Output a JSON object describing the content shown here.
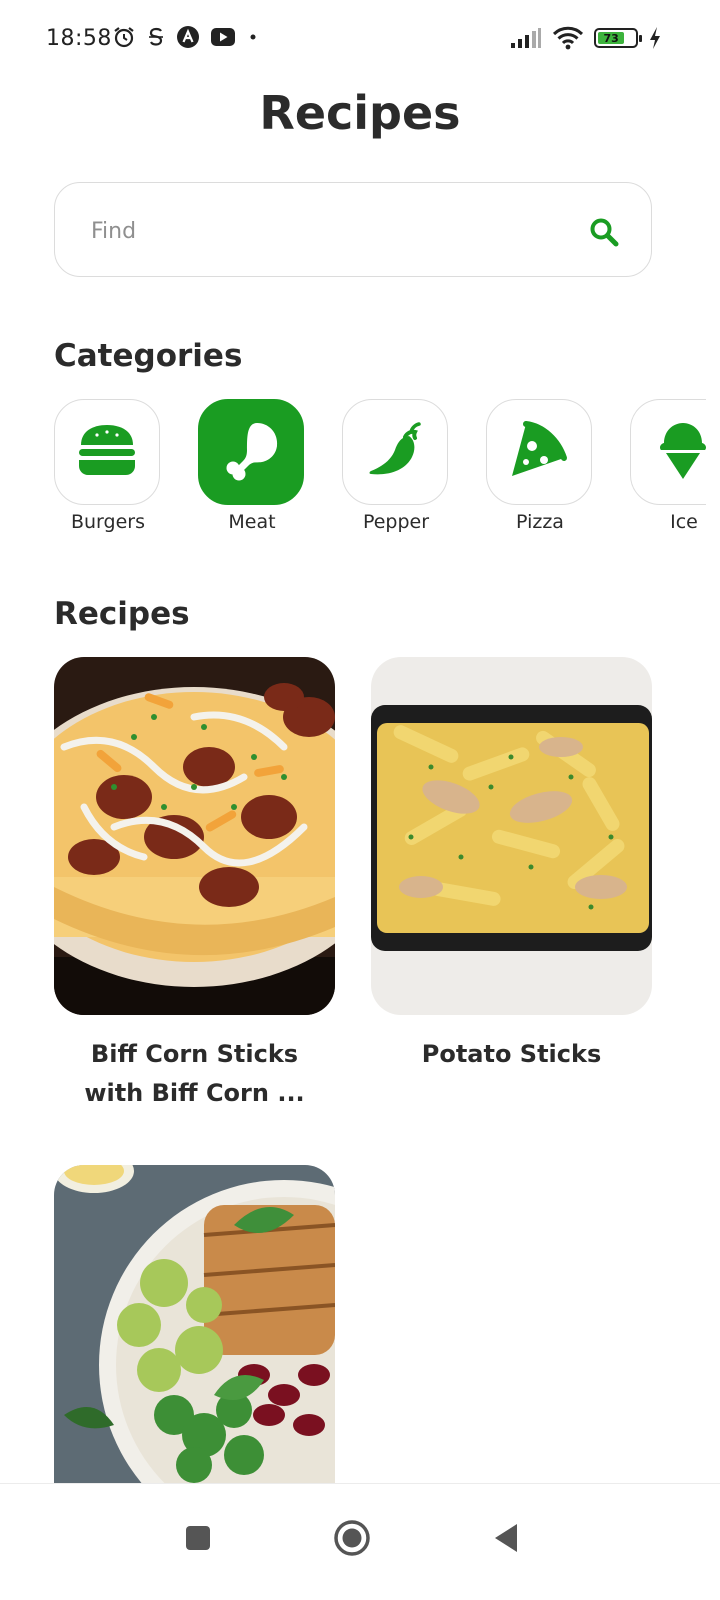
{
  "status_bar": {
    "time": "18:58",
    "battery_level": "73",
    "icons": [
      "alarm-icon",
      "s-badge-icon",
      "a-badge-icon",
      "youtube-icon",
      "dot-icon",
      "signal-icon",
      "wifi-icon",
      "battery-icon",
      "charging-icon"
    ]
  },
  "header": {
    "title": "Recipes"
  },
  "search": {
    "placeholder": "Find",
    "value": "",
    "icon": "search-icon"
  },
  "categories": {
    "title": "Categories",
    "items": [
      {
        "label": "Burgers",
        "icon": "burger-icon",
        "active": false
      },
      {
        "label": "Meat",
        "icon": "drumstick-icon",
        "active": true
      },
      {
        "label": "Pepper",
        "icon": "chili-pepper-icon",
        "active": false
      },
      {
        "label": "Pizza",
        "icon": "pizza-slice-icon",
        "active": false
      },
      {
        "label": "Ice",
        "icon": "ice-cream-icon",
        "active": false
      }
    ]
  },
  "recipes": {
    "title": "Recipes",
    "items": [
      {
        "title": "Biff Corn Sticks with Biff Corn ..."
      },
      {
        "title": "Potato Sticks"
      },
      {
        "title": ""
      }
    ]
  },
  "colors": {
    "accent": "#1a9c22",
    "text": "#2b2b2b",
    "border": "#dcdcdc"
  },
  "nav": {
    "icons": [
      "recents-square-icon",
      "home-circle-icon",
      "back-triangle-icon"
    ]
  }
}
